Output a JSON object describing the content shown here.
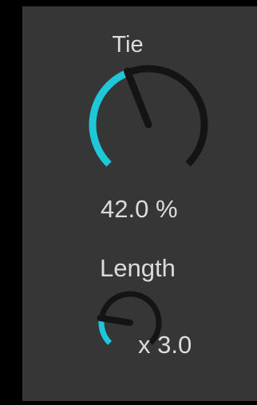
{
  "device": {
    "tie": {
      "label": "Tie",
      "value_text": "42.0 %",
      "value_fraction": 0.42
    },
    "length": {
      "label": "Length",
      "value_text": "x 3.0",
      "value_fraction": 0.2
    }
  },
  "colors": {
    "panel_background": "#363636",
    "outer_background": "#000000",
    "knob_track": "#141414",
    "knob_fill": "#1fc8d8",
    "knob_pointer": "#141414",
    "text": "#dcdcdc"
  }
}
